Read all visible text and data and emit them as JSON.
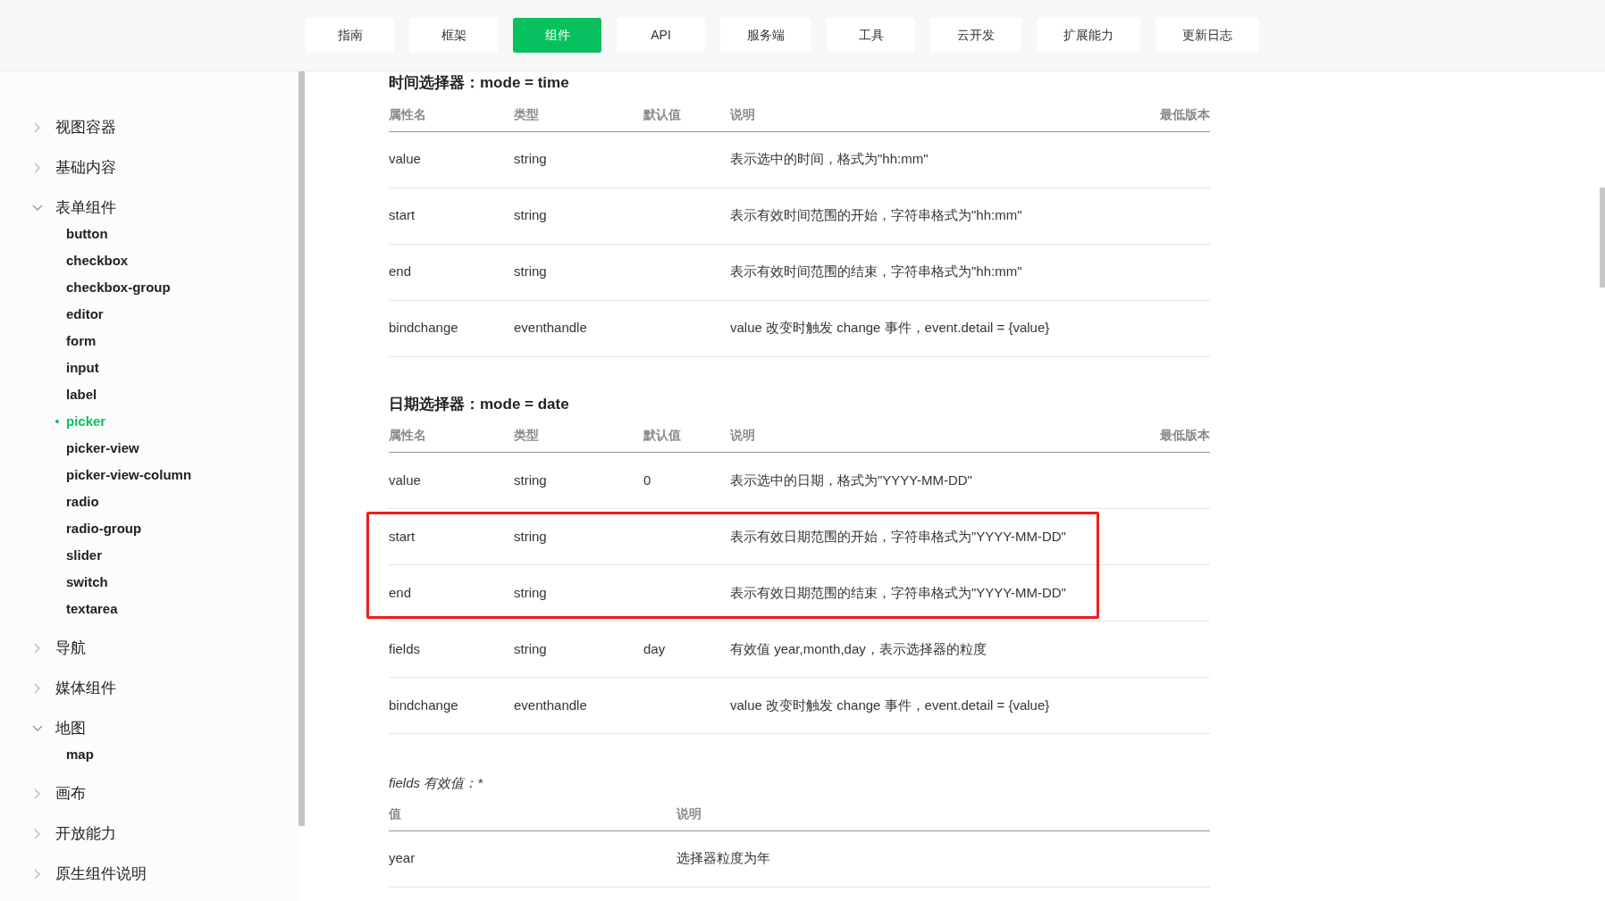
{
  "nav": [
    {
      "label": "指南",
      "selected": false
    },
    {
      "label": "框架",
      "selected": false
    },
    {
      "label": "组件",
      "selected": true
    },
    {
      "label": "API",
      "selected": false
    },
    {
      "label": "服务端",
      "selected": false
    },
    {
      "label": "工具",
      "selected": false
    },
    {
      "label": "云开发",
      "selected": false
    },
    {
      "label": "扩展能力",
      "selected": false
    },
    {
      "label": "更新日志",
      "selected": false
    }
  ],
  "sidebar": [
    {
      "label": "视图容器",
      "expanded": false
    },
    {
      "label": "基础内容",
      "expanded": false
    },
    {
      "label": "表单组件",
      "expanded": true,
      "children": [
        {
          "label": "button",
          "selected": false
        },
        {
          "label": "checkbox",
          "selected": false
        },
        {
          "label": "checkbox-group",
          "selected": false
        },
        {
          "label": "editor",
          "selected": false
        },
        {
          "label": "form",
          "selected": false
        },
        {
          "label": "input",
          "selected": false
        },
        {
          "label": "label",
          "selected": false
        },
        {
          "label": "picker",
          "selected": true
        },
        {
          "label": "picker-view",
          "selected": false
        },
        {
          "label": "picker-view-column",
          "selected": false
        },
        {
          "label": "radio",
          "selected": false
        },
        {
          "label": "radio-group",
          "selected": false
        },
        {
          "label": "slider",
          "selected": false
        },
        {
          "label": "switch",
          "selected": false
        },
        {
          "label": "textarea",
          "selected": false
        }
      ]
    },
    {
      "label": "导航",
      "expanded": false
    },
    {
      "label": "媒体组件",
      "expanded": false
    },
    {
      "label": "地图",
      "expanded": true,
      "children": [
        {
          "label": "map",
          "selected": false
        }
      ]
    },
    {
      "label": "画布",
      "expanded": false
    },
    {
      "label": "开放能力",
      "expanded": false
    },
    {
      "label": "原生组件说明",
      "expanded": false
    }
  ],
  "sections": [
    {
      "kind": "mode",
      "title": "时间选择器：mode = time",
      "columns": [
        "属性名",
        "类型",
        "默认值",
        "说明",
        "最低版本"
      ],
      "rows": [
        {
          "name": "value",
          "type": "string",
          "description": "表示选中的时间，格式为\"hh:mm\"",
          "highlighted": false
        },
        {
          "name": "start",
          "type": "string",
          "description": "表示有效时间范围的开始，字符串格式为\"hh:mm\"",
          "highlighted": false
        },
        {
          "name": "end",
          "type": "string",
          "description": "表示有效时间范围的结束，字符串格式为\"hh:mm\"",
          "highlighted": false
        },
        {
          "name": "bindchange",
          "type": "eventhandle",
          "description": "value 改变时触发 change 事件，event.detail = {value}",
          "highlighted": false
        }
      ]
    },
    {
      "kind": "mode",
      "title": "日期选择器：mode = date",
      "columns": [
        "属性名",
        "类型",
        "默认值",
        "说明",
        "最低版本"
      ],
      "rows": [
        {
          "name": "value",
          "type": "string",
          "default": "0",
          "description": "表示选中的日期，格式为\"YYYY-MM-DD\"",
          "highlighted": false
        },
        {
          "name": "start",
          "type": "string",
          "description": "表示有效日期范围的开始，字符串格式为\"YYYY-MM-DD\"",
          "highlighted": true
        },
        {
          "name": "end",
          "type": "string",
          "description": "表示有效日期范围的结束，字符串格式为\"YYYY-MM-DD\"",
          "highlighted": true
        },
        {
          "name": "fields",
          "type": "string",
          "default": "day",
          "description": "有效值 year,month,day，表示选择器的粒度",
          "highlighted": false
        },
        {
          "name": "bindchange",
          "type": "eventhandle",
          "description": "value 改变时触发 change 事件，event.detail = {value}",
          "highlighted": false
        }
      ]
    },
    {
      "kind": "values",
      "title": "fields 有效值：*",
      "columns": [
        "值",
        "说明"
      ],
      "rows": [
        {
          "name": "year",
          "description": "选择器粒度为年",
          "highlighted": false
        }
      ]
    }
  ]
}
